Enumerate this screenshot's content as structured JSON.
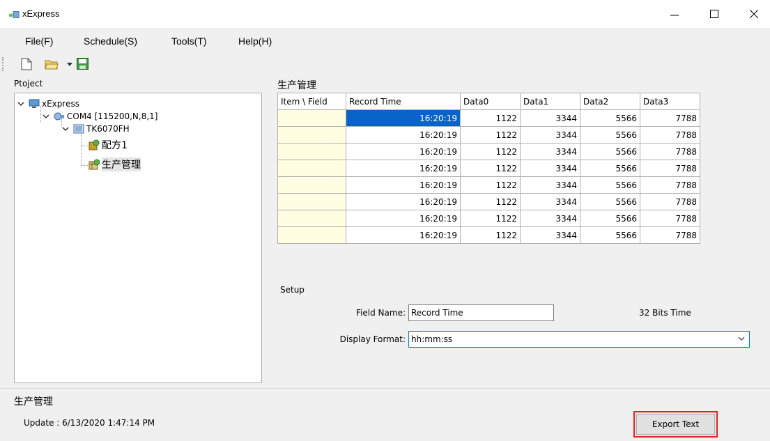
{
  "window": {
    "title": "xExpress"
  },
  "menu": [
    "File(F)",
    "Schedule(S)",
    "Tools(T)",
    "Help(H)"
  ],
  "toolbar": {
    "icons": [
      "new-file-icon",
      "open-folder-icon",
      "dropdown-arrow-icon",
      "save-icon"
    ]
  },
  "project": {
    "label": "Ptoject",
    "tree": [
      {
        "label": "xExpress",
        "icon": "computer-icon"
      },
      {
        "label": "COM4 [115200,N,8,1]",
        "icon": "serial-port-icon"
      },
      {
        "label": "TK6070FH",
        "icon": "hmi-device-icon"
      },
      {
        "label": "配方1",
        "icon": "recipe-icon"
      },
      {
        "label": "生产管理",
        "icon": "data-table-icon"
      }
    ]
  },
  "sheet": {
    "title": "生产管理",
    "columns": [
      "Item \\ Field",
      "Record Time",
      "Data0",
      "Data1",
      "Data2",
      "Data3"
    ],
    "rows": [
      [
        "",
        "16:20:19",
        "1122",
        "3344",
        "5566",
        "7788"
      ],
      [
        "",
        "16:20:19",
        "1122",
        "3344",
        "5566",
        "7788"
      ],
      [
        "",
        "16:20:19",
        "1122",
        "3344",
        "5566",
        "7788"
      ],
      [
        "",
        "16:20:19",
        "1122",
        "3344",
        "5566",
        "7788"
      ],
      [
        "",
        "16:20:19",
        "1122",
        "3344",
        "5566",
        "7788"
      ],
      [
        "",
        "16:20:19",
        "1122",
        "3344",
        "5566",
        "7788"
      ],
      [
        "",
        "16:20:19",
        "1122",
        "3344",
        "5566",
        "7788"
      ],
      [
        "",
        "16:20:19",
        "1122",
        "3344",
        "5566",
        "7788"
      ]
    ]
  },
  "setup": {
    "label": "Setup",
    "field_name_label": "Field Name:",
    "field_name_value": "Record Time",
    "bits_label": "32 Bits Time",
    "display_format_label": "Display Format:",
    "display_format_value": "hh:mm:ss"
  },
  "status": {
    "title": "生产管理",
    "update": "Update : 6/13/2020 1:47:14 PM"
  },
  "export_button": "Export Text",
  "colors": {
    "selection": "#0a64c8",
    "row_header": "#fffde2",
    "highlight_border": "#e02424"
  }
}
